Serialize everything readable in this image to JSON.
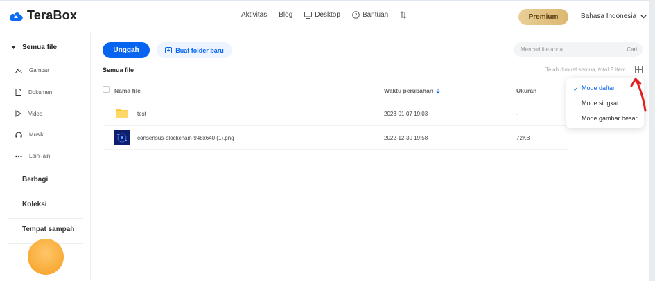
{
  "app": {
    "name": "TeraBox"
  },
  "topnav": {
    "items": [
      {
        "label": "Aktivitas",
        "icon": ""
      },
      {
        "label": "Blog",
        "icon": ""
      },
      {
        "label": "Desktop",
        "icon": "monitor-icon"
      },
      {
        "label": "Bantuan",
        "icon": "help-circle-icon"
      }
    ],
    "transfer_icon": "transfer-arrows-icon",
    "premium_label": "Premium",
    "language": "Bahasa Indonesia"
  },
  "sidebar": {
    "head": "Semua file",
    "sub_items": [
      {
        "label": "Gambar",
        "icon": "image-icon"
      },
      {
        "label": "Dokumen",
        "icon": "document-icon"
      },
      {
        "label": "Video",
        "icon": "play-icon"
      },
      {
        "label": "Musik",
        "icon": "headphones-icon"
      },
      {
        "label": "Lain-lain",
        "icon": "more-dots-icon"
      }
    ],
    "main_items": [
      "Berbagi",
      "Koleksi",
      "Tempat sampah"
    ]
  },
  "toolbar": {
    "upload_label": "Unggah",
    "new_folder_label": "Buat folder baru",
    "search_placeholder": "Mencari file anda",
    "search_button": "Cari"
  },
  "breadcrumb": "Semua file",
  "status": "Telah dimuat semua, total 2 Item",
  "table": {
    "columns": [
      "Nama file",
      "Waktu perubahan",
      "Ukuran"
    ],
    "rows": [
      {
        "name": "test",
        "modified": "2023-01-07 19:03",
        "size": "-",
        "type": "folder"
      },
      {
        "name": "consensus-blockchain-948x640 (1).png",
        "modified": "2022-12-30 19:58",
        "size": "72KB",
        "type": "image"
      }
    ]
  },
  "view_menu": {
    "items": [
      "Mode daftar",
      "Mode singkat",
      "Mode gambar besar"
    ],
    "selected": "Mode daftar"
  },
  "colors": {
    "accent": "#0664f1",
    "premium": "#dcb771",
    "annotation": "#e02020"
  }
}
